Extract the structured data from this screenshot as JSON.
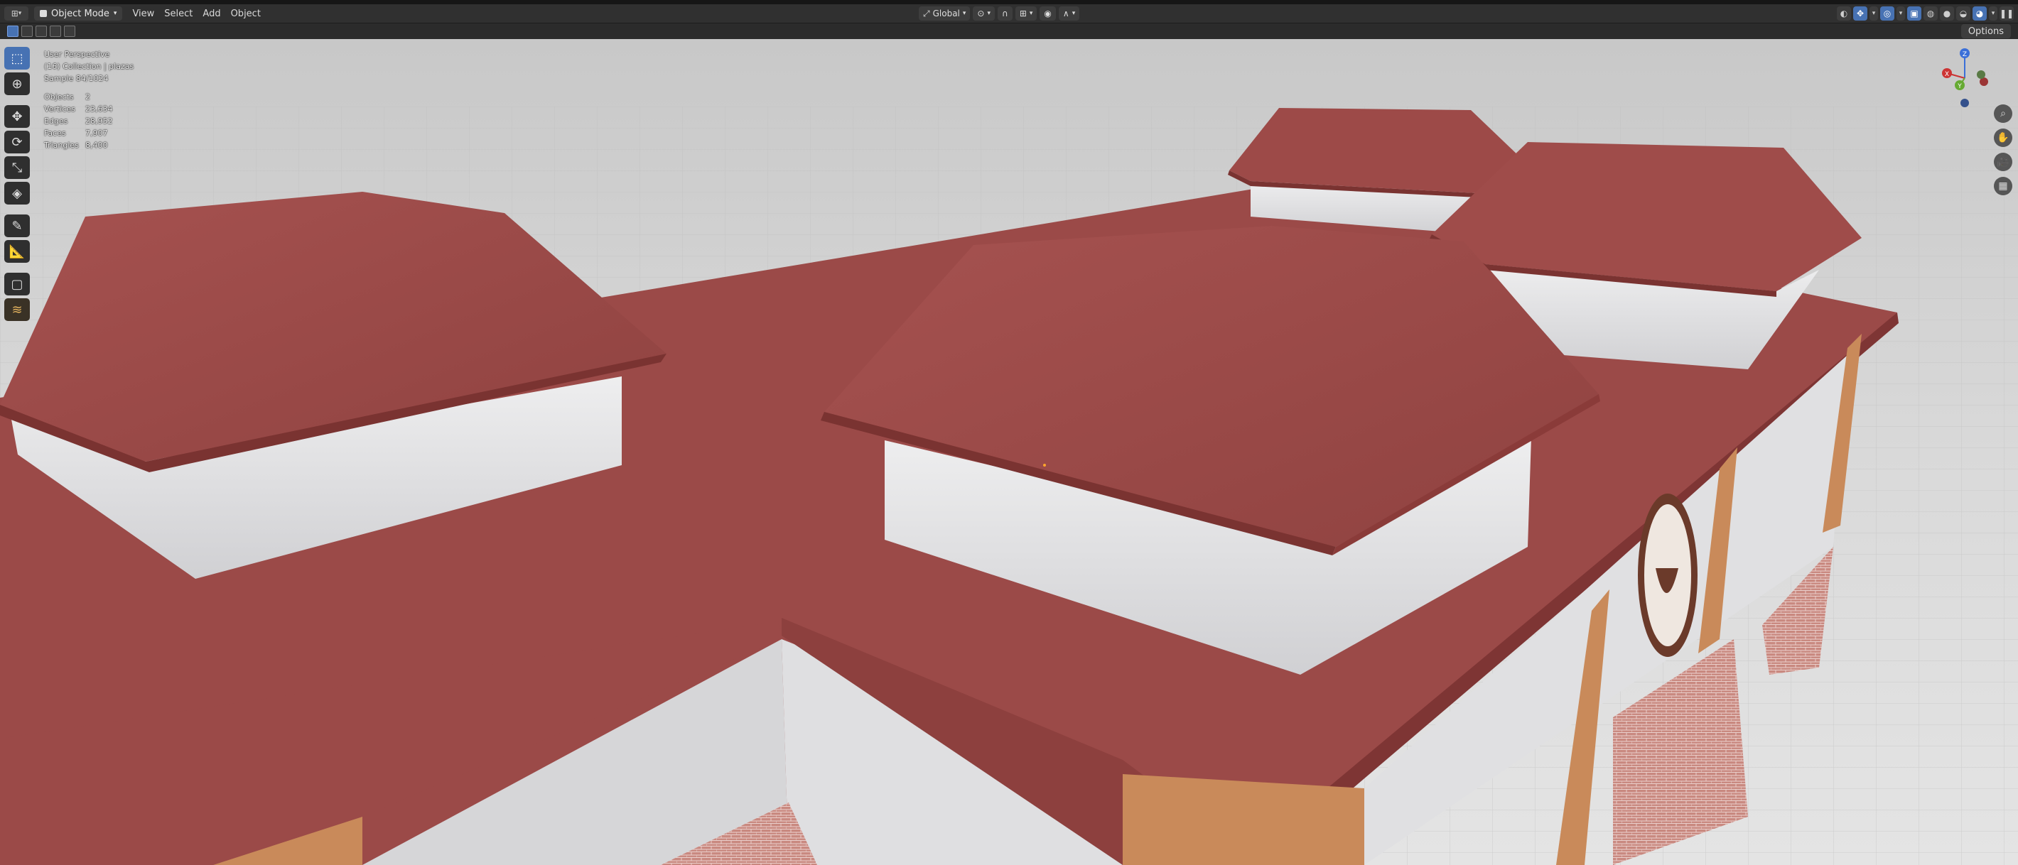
{
  "header": {
    "editor_type_icon": "3d-viewport-icon",
    "mode": "Object Mode",
    "menus": [
      "View",
      "Select",
      "Add",
      "Object"
    ],
    "orientation": "Global",
    "options_label": "Options"
  },
  "overlay": {
    "view_name": "User Perspective",
    "collection": "(16) Collection | plazas",
    "sample": "Sample 84/1024"
  },
  "stats": [
    {
      "label": "Objects",
      "value": "2"
    },
    {
      "label": "Vertices",
      "value": "23,634"
    },
    {
      "label": "Edges",
      "value": "28,952"
    },
    {
      "label": "Faces",
      "value": "7,907"
    },
    {
      "label": "Triangles",
      "value": "8,400"
    }
  ],
  "tools": [
    "select-box-icon",
    "cursor-icon",
    "move-icon",
    "rotate-icon",
    "scale-icon",
    "transform-icon",
    "annotate-icon",
    "measure-icon",
    "add-cube-icon",
    "shader-ball-icon"
  ],
  "gizmo": {
    "x_label": "X",
    "y_label": "Y",
    "z_label": "Z"
  },
  "colors": {
    "roof": "#9a4a48",
    "roof_dark": "#7b3332",
    "wall": "#e3e3e6",
    "pillar": "#c98a5a",
    "accent": "#4772b3"
  }
}
